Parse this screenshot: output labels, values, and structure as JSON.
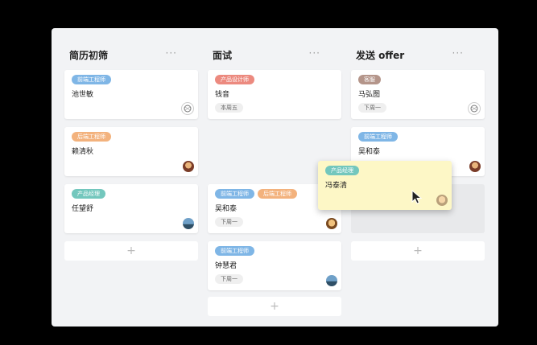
{
  "columns": [
    {
      "title": "简历初筛",
      "more": "···",
      "add": "+"
    },
    {
      "title": "面试",
      "more": "···",
      "add": "+"
    },
    {
      "title": "发送 offer",
      "more": "···",
      "add": "+"
    }
  ],
  "cards": {
    "c1": {
      "tags": [
        "前端工程师"
      ],
      "name": "池世敏"
    },
    "c2": {
      "tags": [
        "后端工程师"
      ],
      "name": "赖清秋"
    },
    "c3": {
      "tags": [
        "产品经理"
      ],
      "name": "任望舒"
    },
    "c4": {
      "tags": [
        "产品设计师"
      ],
      "name": "钱音",
      "date": "本周五"
    },
    "c5": {
      "tags": [
        "前端工程师",
        "后端工程师"
      ],
      "name": "吴和泰",
      "date": "下周一"
    },
    "c6": {
      "tags": [
        "前端工程师"
      ],
      "name": "钟慧君",
      "date": "下周一"
    },
    "c7": {
      "tags": [
        "客服"
      ],
      "name": "马弘图",
      "date": "下周一"
    },
    "c8": {
      "tags": [
        "前端工程师"
      ],
      "name": "吴和泰"
    },
    "drag": {
      "tags": [
        "产品经理"
      ],
      "name": "冯泰清"
    }
  },
  "colors": {
    "frontend": "#7fb6e6",
    "backend": "#f3b27d",
    "product_manager": "#73c7bd",
    "designer": "#ec8a7f",
    "support": "#b4958a",
    "drag_bg": "#fdf7c6"
  },
  "icons": {
    "avatar_outline": "avatar-outline-icon",
    "avatar_photo": "avatar-photo-icon",
    "cursor": "mouse-cursor-icon"
  }
}
